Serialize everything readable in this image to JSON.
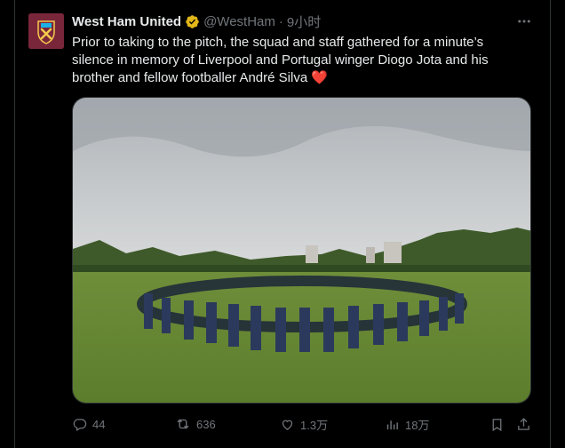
{
  "tweet": {
    "author_name": "West Ham United",
    "handle": "@WestHam",
    "separator": "·",
    "time": "9小时",
    "text": "Prior to taking to the pitch, the squad and staff gathered for a minute’s silence in memory of Liverpool and Portugal winger Diogo Jota and his brother and fellow footballer André Silva ❤️",
    "verified_badge_color": "#e2b719",
    "brand_color": "#7a263a"
  },
  "media": {
    "description_icon": "photo"
  },
  "actions": {
    "replies": "44",
    "retweets": "636",
    "likes": "1.3万",
    "views": "18万"
  },
  "icons": {
    "verified": "verified-badge-icon",
    "more": "more-icon",
    "reply": "reply-icon",
    "retweet": "retweet-icon",
    "like": "heart-icon",
    "views": "views-icon",
    "bookmark": "bookmark-icon",
    "share": "share-icon"
  }
}
